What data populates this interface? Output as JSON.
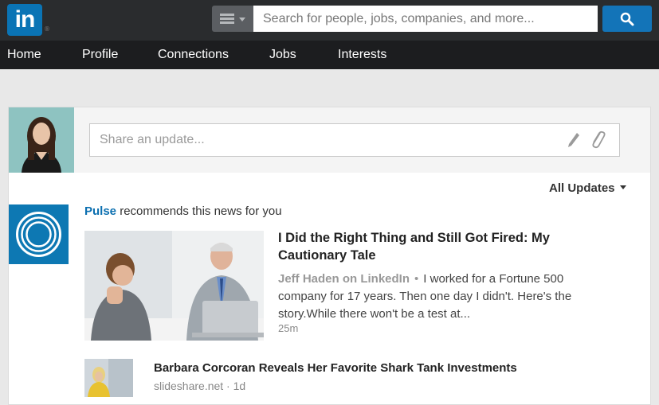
{
  "header": {
    "logo_text": "in",
    "logo_mark": "®",
    "search_placeholder": "Search for people, jobs, companies, and more...",
    "search_icon": "search-icon",
    "category_icon": "list-menu-icon"
  },
  "nav": {
    "items": [
      {
        "label": "Home"
      },
      {
        "label": "Profile"
      },
      {
        "label": "Connections"
      },
      {
        "label": "Jobs"
      },
      {
        "label": "Interests"
      }
    ]
  },
  "share": {
    "placeholder": "Share an update...",
    "pencil_icon": "pencil-icon",
    "attach_icon": "paperclip-icon"
  },
  "feed": {
    "filter_label": "All Updates",
    "pulse_brand": "Pulse",
    "pulse_text": " recommends this news for you",
    "article": {
      "title": "I Did the Right Thing and Still Got Fired: My Cautionary Tale",
      "source": "Jeff Haden on LinkedIn",
      "separator": "•",
      "excerpt": "I worked for a Fortune 500 company for 17 years. Then one day I didn't. Here's the story.While there won't be a test at...",
      "time": "25m"
    },
    "item2": {
      "title": "Barbara Corcoran Reveals Her Favorite Shark Tank Investments",
      "meta": "slideshare.net · 1d"
    }
  },
  "colors": {
    "brand_blue": "#0a74b5",
    "topbar": "#2a2c2e",
    "navbar": "#1c1d1f",
    "link_blue": "#0b6fb0"
  }
}
